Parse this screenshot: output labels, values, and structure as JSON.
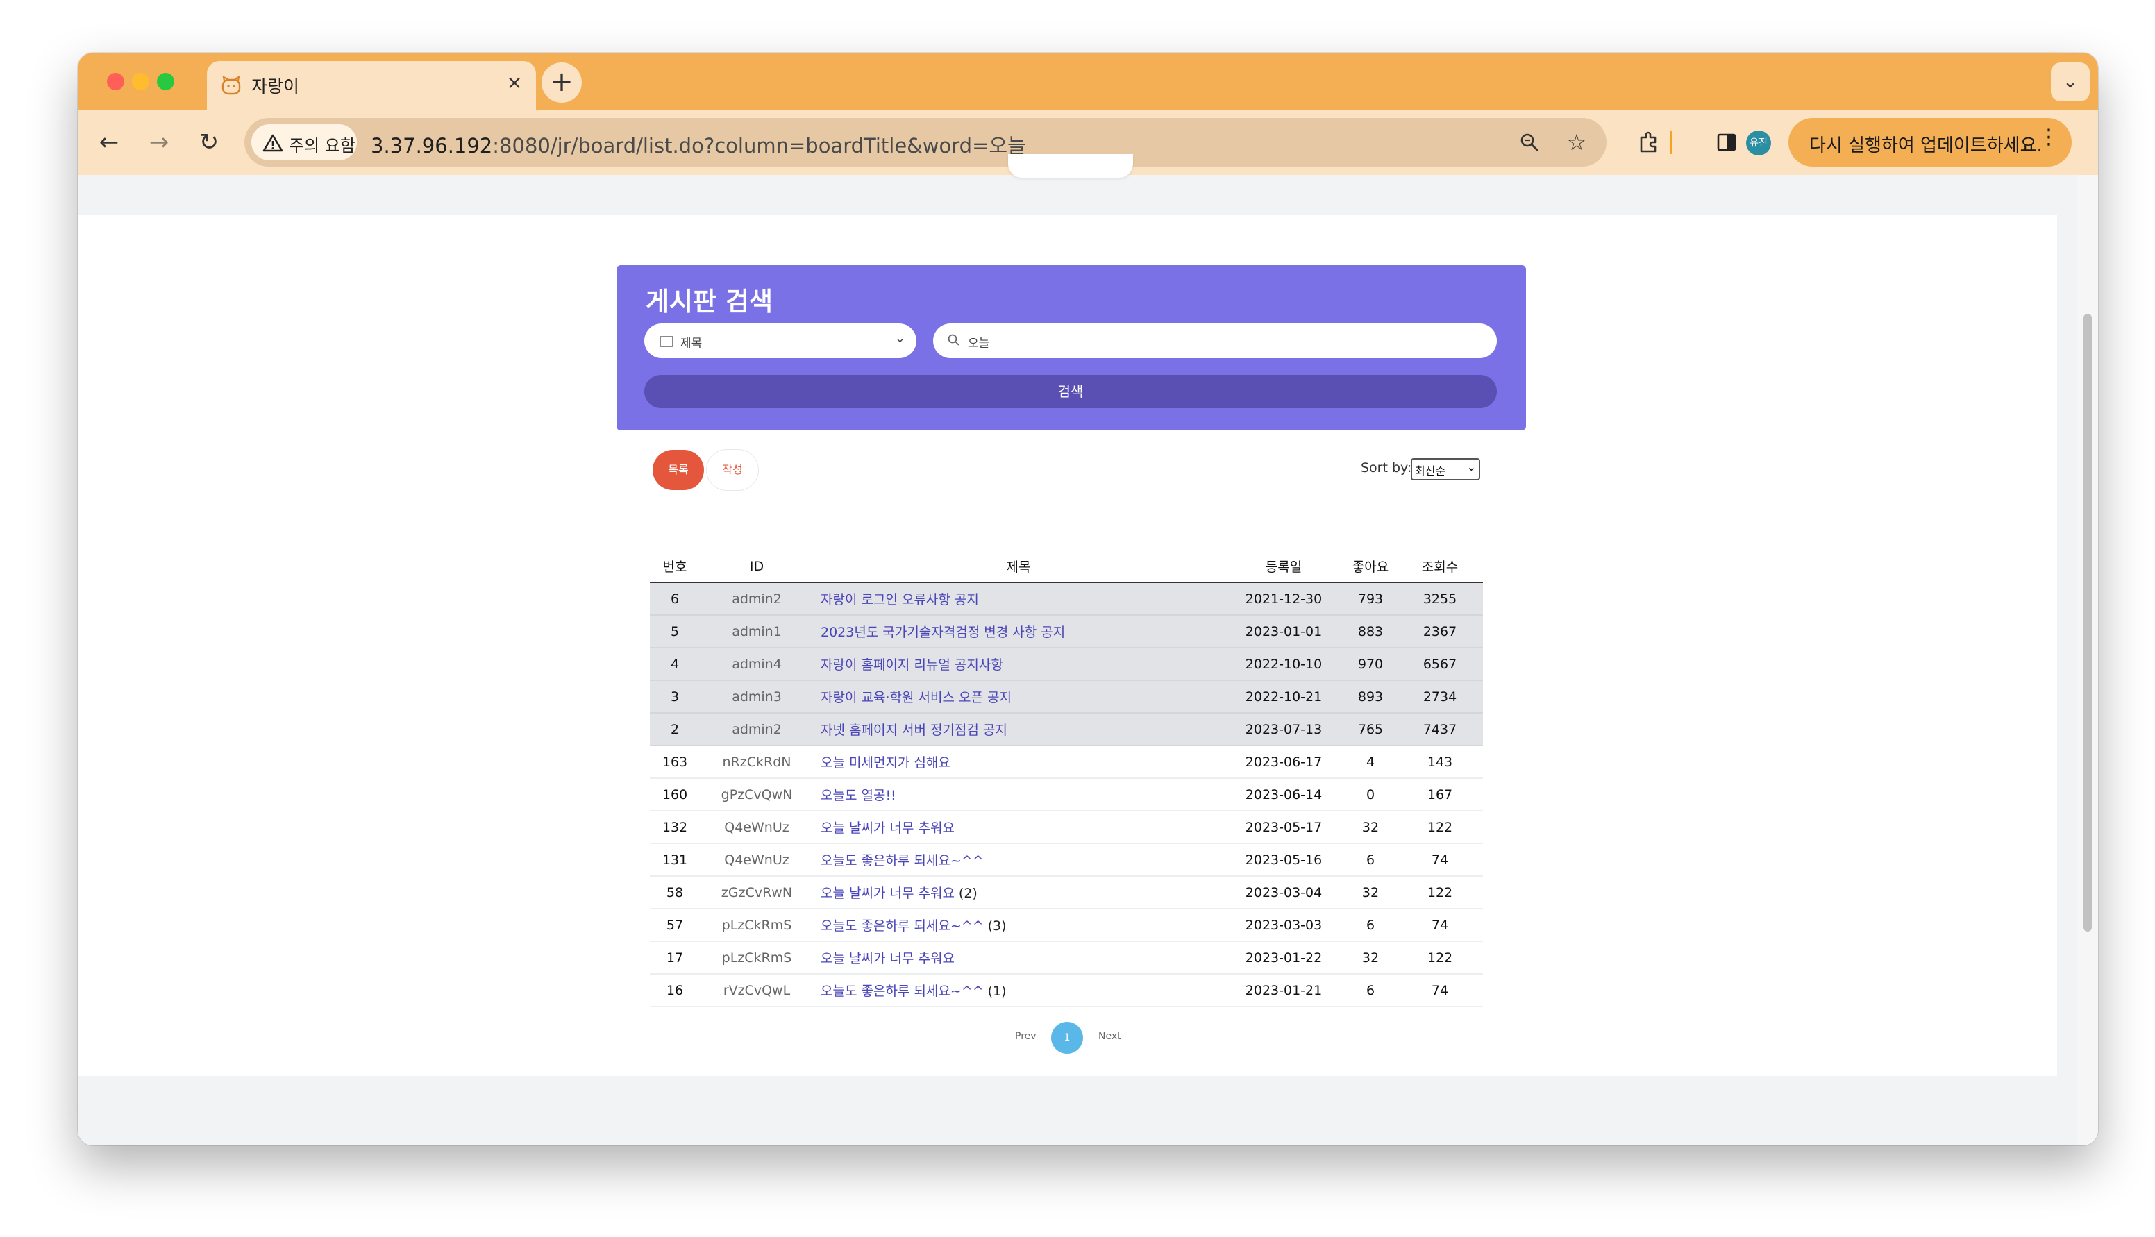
{
  "browser": {
    "tab_title": "자랑이",
    "tab_close": "×",
    "new_tab": "+",
    "security_chip": "주의 요함",
    "url_host": "3.37.96.192",
    "url_rest": ":8080/jr/board/list.do?column=boardTitle&word=오늘",
    "profile_initials": "유진",
    "update_label": "다시 실행하여 업데이트하세요.",
    "accent_color": "#f4af55"
  },
  "search": {
    "title": "게시판 검색",
    "column_value": "제목",
    "keyword_value": "오늘",
    "button_label": "검색",
    "card_color": "#7b71e6"
  },
  "actions": {
    "list_label": "목록",
    "write_label": "작성",
    "sort_label": "Sort by:",
    "sort_value": "최신순"
  },
  "table": {
    "headers": {
      "no": "번호",
      "id": "ID",
      "title": "제목",
      "date": "등록일",
      "likes": "좋아요",
      "views": "조회수"
    },
    "notices": [
      {
        "no": "6",
        "id": "admin2",
        "title": "자랑이 로그인 오류사항 공지",
        "suffix": "",
        "date": "2021-12-30",
        "likes": "793",
        "views": "3255"
      },
      {
        "no": "5",
        "id": "admin1",
        "title": "2023년도 국가기술자격검정 변경 사항 공지",
        "suffix": "",
        "date": "2023-01-01",
        "likes": "883",
        "views": "2367"
      },
      {
        "no": "4",
        "id": "admin4",
        "title": "자랑이 홈페이지 리뉴얼 공지사항",
        "suffix": "",
        "date": "2022-10-10",
        "likes": "970",
        "views": "6567"
      },
      {
        "no": "3",
        "id": "admin3",
        "title": "자랑이 교육·학원 서비스 오픈 공지",
        "suffix": "",
        "date": "2022-10-21",
        "likes": "893",
        "views": "2734"
      },
      {
        "no": "2",
        "id": "admin2",
        "title": "자넷 홈페이지 서버 정기점검 공지",
        "suffix": "",
        "date": "2023-07-13",
        "likes": "765",
        "views": "7437"
      }
    ],
    "rows": [
      {
        "no": "163",
        "id": "nRzCkRdN",
        "title": "오늘 미세먼지가 심해요",
        "suffix": "",
        "date": "2023-06-17",
        "likes": "4",
        "views": "143"
      },
      {
        "no": "160",
        "id": "gPzCvQwN",
        "title": "오늘도 열공!!",
        "suffix": "",
        "date": "2023-06-14",
        "likes": "0",
        "views": "167"
      },
      {
        "no": "132",
        "id": "Q4eWnUz",
        "title": "오늘 날씨가 너무 추워요",
        "suffix": "",
        "date": "2023-05-17",
        "likes": "32",
        "views": "122"
      },
      {
        "no": "131",
        "id": "Q4eWnUz",
        "title": "오늘도 좋은하루 되세요~^^",
        "suffix": "",
        "date": "2023-05-16",
        "likes": "6",
        "views": "74"
      },
      {
        "no": "58",
        "id": "zGzCvRwN",
        "title": "오늘 날씨가 너무 추워요",
        "suffix": "(2)",
        "date": "2023-03-04",
        "likes": "32",
        "views": "122"
      },
      {
        "no": "57",
        "id": "pLzCkRmS",
        "title": "오늘도 좋은하루 되세요~^^",
        "suffix": "(3)",
        "date": "2023-03-03",
        "likes": "6",
        "views": "74"
      },
      {
        "no": "17",
        "id": "pLzCkRmS",
        "title": "오늘 날씨가 너무 추워요",
        "suffix": "",
        "date": "2023-01-22",
        "likes": "32",
        "views": "122"
      },
      {
        "no": "16",
        "id": "rVzCvQwL",
        "title": "오늘도 좋은하루 되세요~^^",
        "suffix": "(1)",
        "date": "2023-01-21",
        "likes": "6",
        "views": "74"
      }
    ]
  },
  "pagination": {
    "prev": "Prev",
    "current": "1",
    "next": "Next"
  }
}
